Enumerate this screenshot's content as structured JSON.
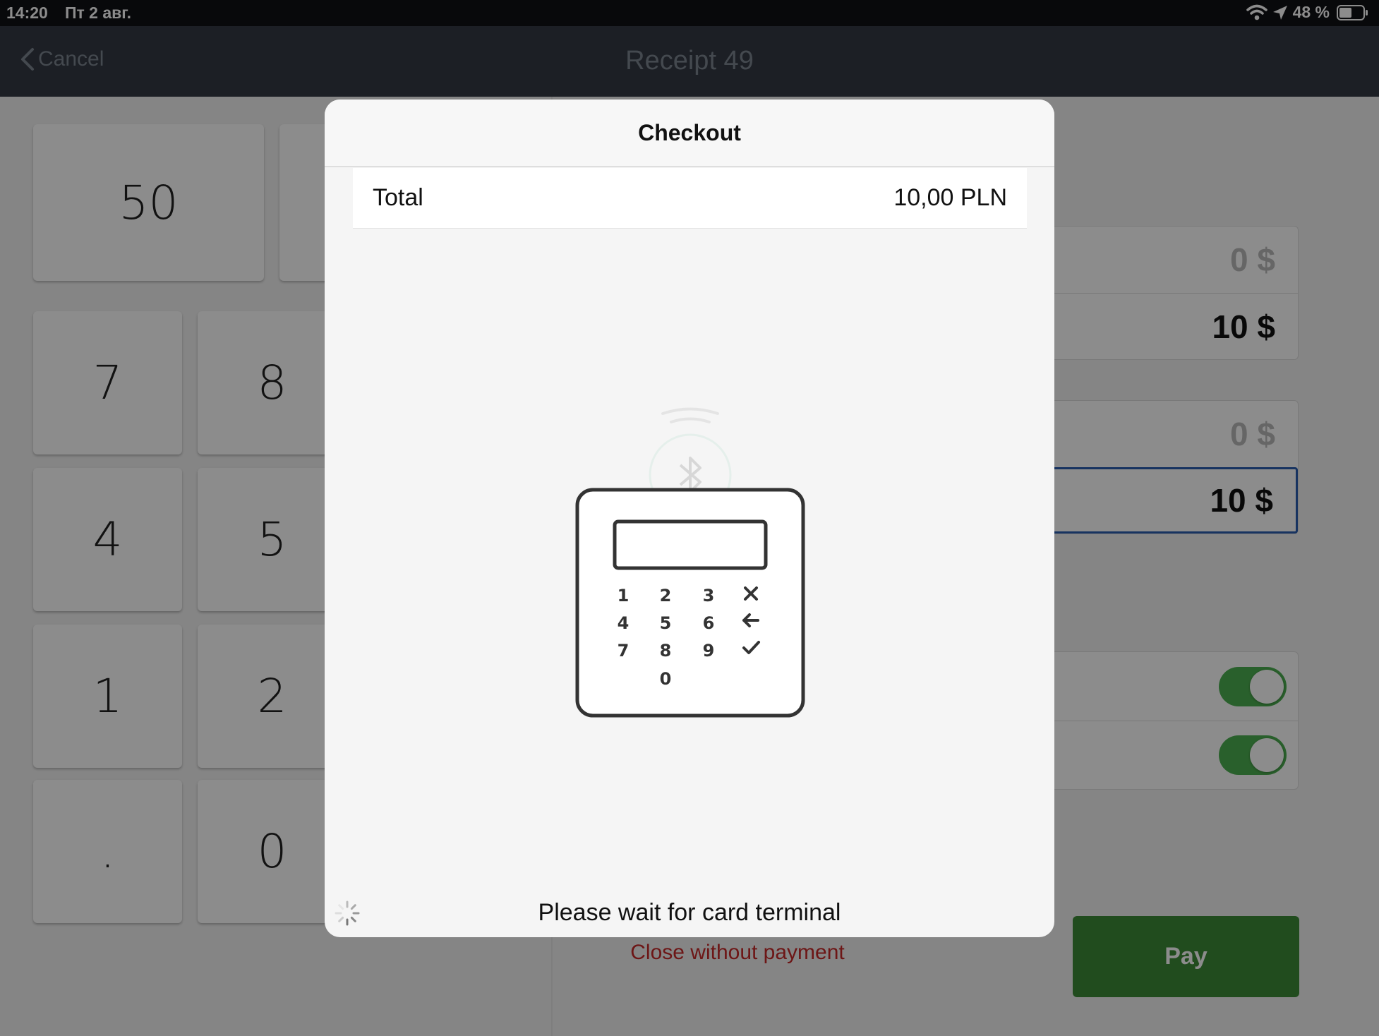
{
  "status_bar": {
    "time": "14:20",
    "date": "Пт 2 авг.",
    "battery_percent": "48 %",
    "icons": [
      "wifi-icon",
      "location-icon",
      "battery-icon"
    ]
  },
  "navbar": {
    "back_label": "Cancel",
    "title": "Receipt 49"
  },
  "keypad": {
    "quick_amount": "50",
    "keys": [
      "7",
      "8",
      "4",
      "5",
      "1",
      "2",
      ".",
      "0"
    ]
  },
  "payment_panel": {
    "group1": [
      "0 $",
      "10 $"
    ],
    "group2": [
      "0 $",
      "10 $"
    ],
    "toggles": [
      true,
      true
    ]
  },
  "footer": {
    "close_link": "Close without payment",
    "pay_button": "Pay"
  },
  "modal": {
    "title": "Checkout",
    "total_label": "Total",
    "total_value": "10,00 PLN",
    "terminal_keys": [
      "1",
      "2",
      "3",
      "4",
      "5",
      "6",
      "7",
      "8",
      "9",
      "0"
    ],
    "status_text": "Please wait for card terminal"
  },
  "colors": {
    "navbar_bg": "#343a44",
    "pay_green": "#3d8b37",
    "toggle_green": "#4caf50",
    "close_red": "#c62828",
    "selected_border": "#2a5db0"
  }
}
